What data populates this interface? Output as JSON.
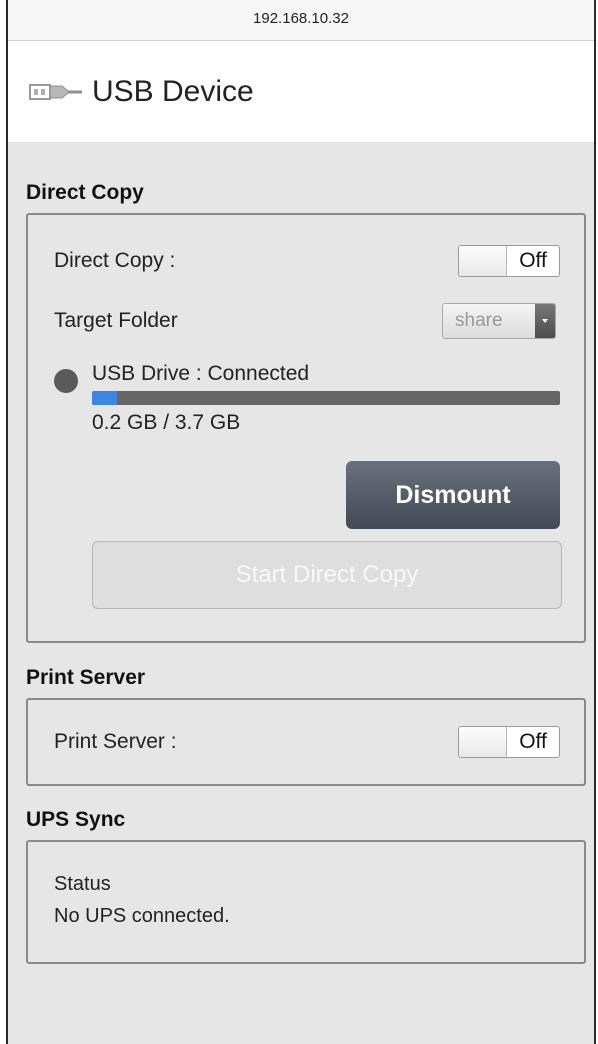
{
  "browser": {
    "address": "192.168.10.32"
  },
  "header": {
    "title": "USB Device",
    "icon": "usb-plug-icon"
  },
  "direct_copy": {
    "section_title": "Direct Copy",
    "direct_copy_label": "Direct Copy :",
    "direct_copy_toggle": "Off",
    "target_folder_label": "Target Folder",
    "target_folder_value": "share",
    "drive_status": "USB Drive : Connected",
    "drive_usage_fraction": 0.054,
    "drive_usage_text": "0.2 GB / 3.7 GB",
    "dismount_label": "Dismount",
    "start_label": "Start Direct Copy"
  },
  "print_server": {
    "section_title": "Print Server",
    "label": "Print Server :",
    "toggle": "Off"
  },
  "ups_sync": {
    "section_title": "UPS Sync",
    "status_label": "Status",
    "status_value": "No UPS connected."
  },
  "colors": {
    "progress_fill": "#3b86e0",
    "progress_track": "#666666",
    "dismount_button": "#545a66"
  }
}
